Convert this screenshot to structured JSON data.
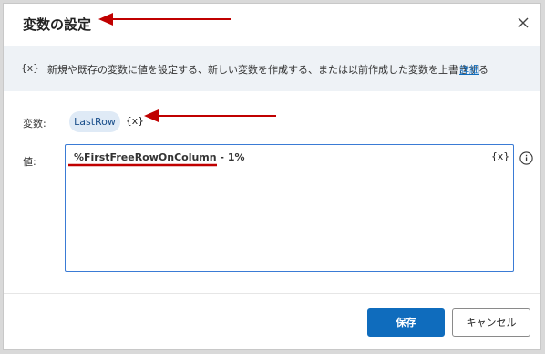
{
  "dialog": {
    "title": "変数の設定",
    "close_icon": "close-icon"
  },
  "info": {
    "icon": "{x}",
    "text": "新規や既存の変数に値を設定する、新しい変数を作成する、または以前作成した変数を上書きする",
    "link": "詳細"
  },
  "form": {
    "variable_label": "変数:",
    "variable_name": "LastRow",
    "variable_picker_icon": "{x}",
    "value_label": "値:",
    "value_text": "%FirstFreeRowOnColumn - 1%",
    "value_picker_icon": "{x}",
    "info_icon": "info-circle-icon"
  },
  "buttons": {
    "save": "保存",
    "cancel": "キャンセル"
  },
  "colors": {
    "accent": "#0f6cbd",
    "annotation": "#c00000"
  }
}
